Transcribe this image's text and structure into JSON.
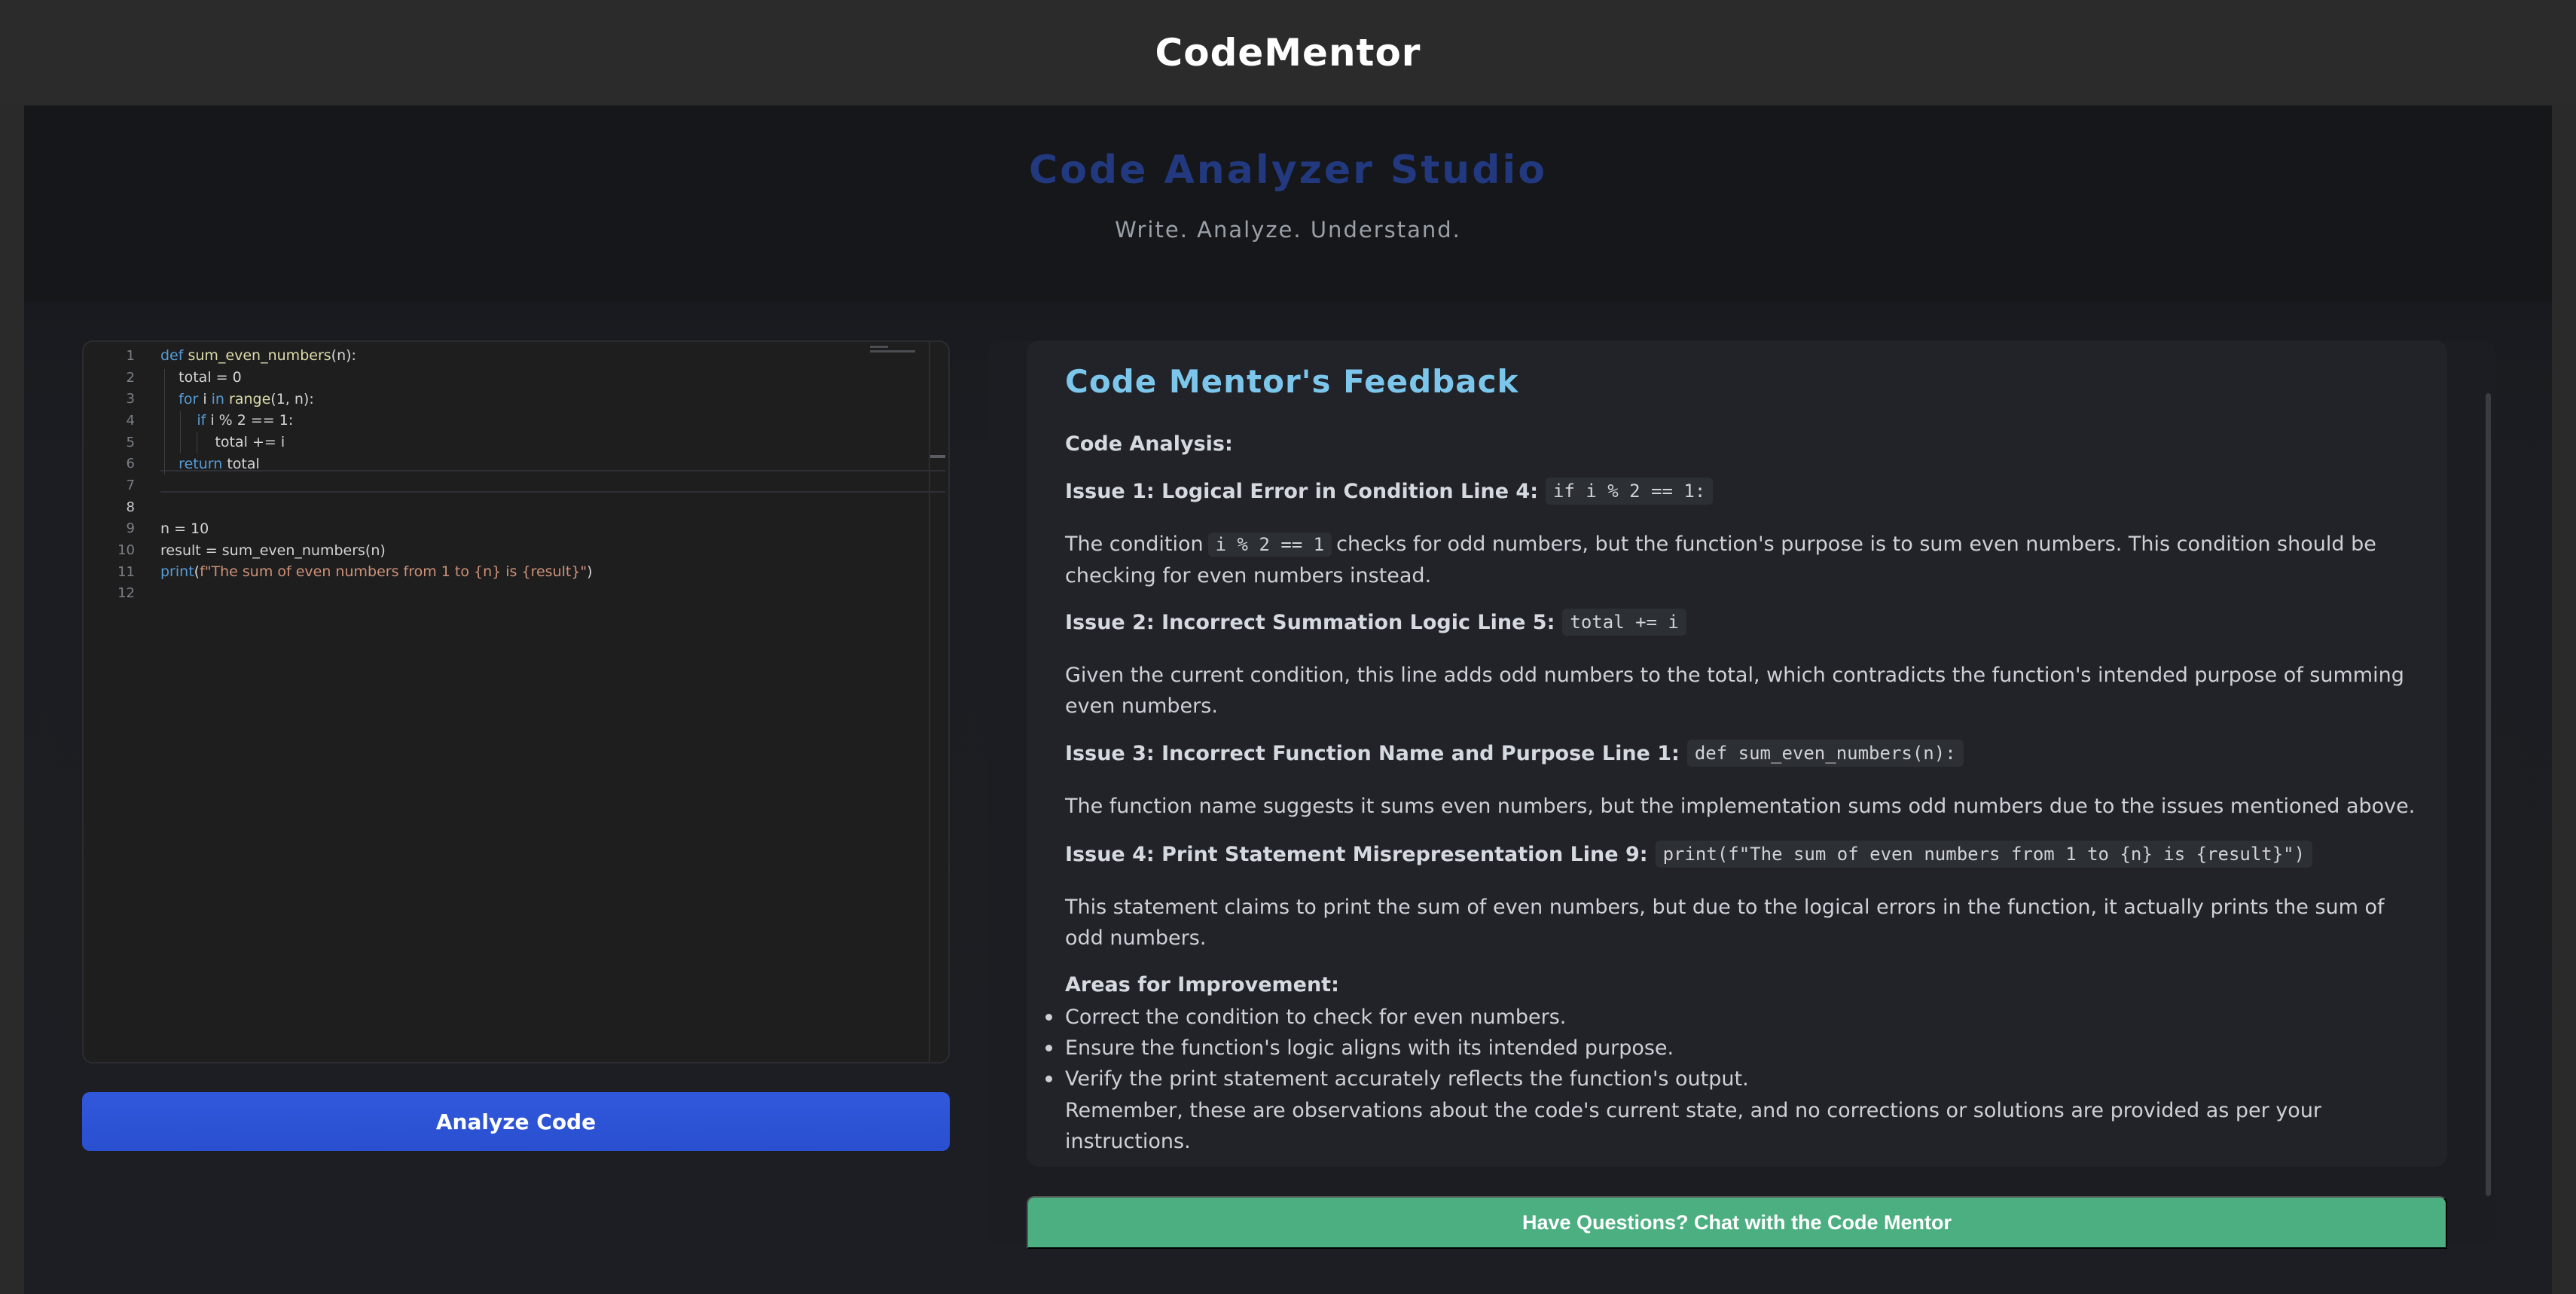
{
  "app": {
    "title": "CodeMentor"
  },
  "hero": {
    "title": "Code Analyzer Studio",
    "subtitle": "Write. Analyze. Understand."
  },
  "editor": {
    "lines": [
      {
        "n": "1",
        "tokens": [
          [
            "kw",
            "def "
          ],
          [
            "fn",
            "sum_even_numbers"
          ],
          [
            "",
            "("
          ],
          [
            "",
            "n"
          ],
          [
            "",
            "):"
          ]
        ]
      },
      {
        "n": "2",
        "tokens": [
          [
            "",
            "    total = 0"
          ]
        ]
      },
      {
        "n": "3",
        "tokens": [
          [
            "",
            "    "
          ],
          [
            "kw",
            "for"
          ],
          [
            "",
            " i "
          ],
          [
            "kw",
            "in"
          ],
          [
            "",
            " "
          ],
          [
            "fn",
            "range"
          ],
          [
            "",
            "(1, n):"
          ]
        ]
      },
      {
        "n": "4",
        "tokens": [
          [
            "",
            "        "
          ],
          [
            "kw",
            "if"
          ],
          [
            "",
            " i % 2 == 1:"
          ]
        ]
      },
      {
        "n": "5",
        "tokens": [
          [
            "",
            "            total += i"
          ]
        ]
      },
      {
        "n": "6",
        "tokens": [
          [
            "",
            "    "
          ],
          [
            "kw",
            "return"
          ],
          [
            "",
            " total"
          ]
        ]
      },
      {
        "n": "7",
        "tokens": []
      },
      {
        "n": "8",
        "tokens": []
      },
      {
        "n": "9",
        "tokens": [
          [
            "",
            "n = 10"
          ]
        ]
      },
      {
        "n": "10",
        "tokens": [
          [
            "",
            "result = sum_even_numbers(n)"
          ]
        ]
      },
      {
        "n": "11",
        "tokens": [
          [
            "kw",
            "print"
          ],
          [
            "",
            "("
          ],
          [
            "str",
            "f\"The sum of even numbers from 1 to {n} is {result}\""
          ],
          [
            "",
            ")"
          ]
        ]
      },
      {
        "n": "12",
        "tokens": []
      }
    ],
    "active_line": "8",
    "analyze_label": "Analyze Code"
  },
  "feedback": {
    "title": "Code Mentor's Feedback",
    "analysis_heading": "Code Analysis:",
    "issues": [
      {
        "label": "Issue 1: Logical Error in Condition Line 4:",
        "code": "if i % 2 == 1:"
      },
      {
        "label": "Issue 2: Incorrect Summation Logic Line 5:",
        "code": "total += i"
      },
      {
        "label": "Issue 3: Incorrect Function Name and Purpose Line 1:",
        "code": "def sum_even_numbers(n):"
      },
      {
        "label": "Issue 4: Print Statement Misrepresentation Line 9:",
        "code": "print(f\"The sum of even numbers from 1 to {n} is {result}\")"
      }
    ],
    "para1_a": "The condition",
    "para1_code": "i % 2 == 1",
    "para1_b": "checks for odd numbers, but the function's purpose is to sum even numbers. This condition should be checking for even numbers instead.",
    "para2": "Given the current condition, this line adds odd numbers to the total, which contradicts the function's intended purpose of summing even numbers.",
    "para3": "The function name suggests it sums even numbers, but the implementation sums odd numbers due to the issues mentioned above.",
    "para4": "This statement claims to print the sum of even numbers, but due to the logical errors in the function, it actually prints the sum of odd numbers.",
    "improvement_heading": "Areas for Improvement:",
    "improvements": [
      "Correct the condition to check for even numbers.",
      "Ensure the function's logic aligns with its intended purpose.",
      "Verify the print statement accurately reflects the function's output."
    ],
    "remember": "Remember, these are observations about the code's current state, and no corrections or solutions are provided as per your instructions.",
    "chat_label": "Have Questions? Chat with the Code Mentor"
  }
}
